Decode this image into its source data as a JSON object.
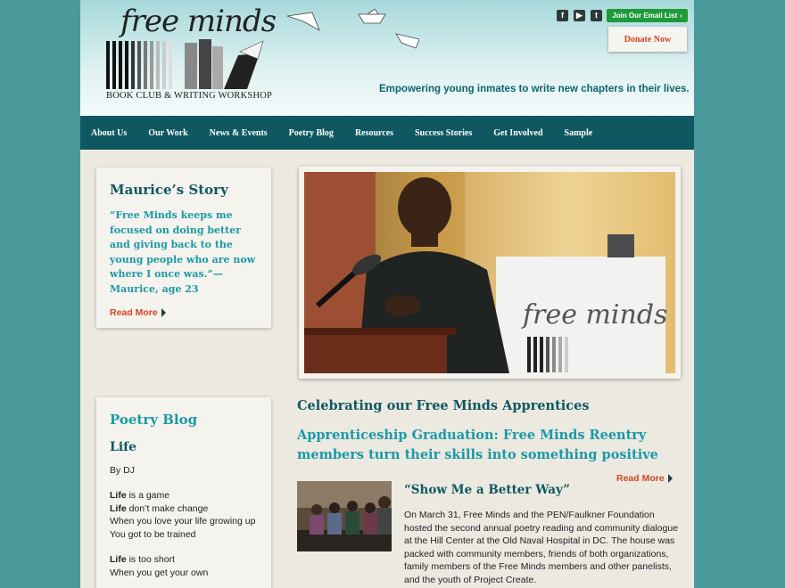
{
  "header": {
    "logo_script": "free minds",
    "logo_tagline": "BOOK CLUB & WRITING WORKSHOP",
    "email_button": "Join Our Email List",
    "donate_button": "Donate Now",
    "tagline": "Empowering young inmates to write new chapters in their lives.",
    "social": [
      {
        "icon": "facebook-icon",
        "glyph": "f"
      },
      {
        "icon": "youtube-icon",
        "glyph": "▶"
      },
      {
        "icon": "twitter-icon",
        "glyph": "t"
      }
    ]
  },
  "nav": {
    "items": [
      {
        "label": "About Us"
      },
      {
        "label": "Our Work"
      },
      {
        "label": "News & Events"
      },
      {
        "label": "Poetry Blog"
      },
      {
        "label": "Resources"
      },
      {
        "label": "Success Stories"
      },
      {
        "label": "Get Involved"
      },
      {
        "label": "Sample"
      }
    ]
  },
  "story_card": {
    "title": "Maurice’s Story",
    "quote": "“Free Minds keeps me focused on doing better and giving back to the young people who are now where I once was.”—Maurice, age 23",
    "read_more": "Read More"
  },
  "poetry_card": {
    "title": "Poetry Blog",
    "post_title": "Life",
    "byline": "By DJ",
    "stanza1": [
      {
        "bold": "Life",
        "rest": " is a game"
      },
      {
        "bold": "Life",
        "rest": " don’t make change"
      },
      {
        "bold": "",
        "rest": "When you love your life growing up"
      },
      {
        "bold": "",
        "rest": "You got to be trained"
      }
    ],
    "stanza2": [
      {
        "bold": "Life",
        "rest": " is too short"
      },
      {
        "bold": "",
        "rest": "When you get your own"
      }
    ]
  },
  "hero": {
    "sign_text": "free minds"
  },
  "main": {
    "heading": "Celebrating our Free Minds Apprentices",
    "subheading": "Apprenticeship Graduation: Free Minds Reentry members turn their skills into something positive",
    "read_more": "Read More",
    "story_title": "“Show Me a Better Way”",
    "story_body": "On March 31, Free Minds and the PEN/Faulkner Foundation hosted the second annual poetry reading and community dialogue at the Hill Center at the Old Naval Hospital in DC. The house was packed with community members, friends of both organizations, family members of the Free Minds members and other panelists, and the youth of Project Create."
  },
  "colors": {
    "background": "#4a9a9c",
    "nav": "#0f5861",
    "teal_text": "#1a9aa6",
    "dark_teal": "#0f5861",
    "accent_orange": "#d3461b",
    "email_green": "#1d9a3a"
  }
}
